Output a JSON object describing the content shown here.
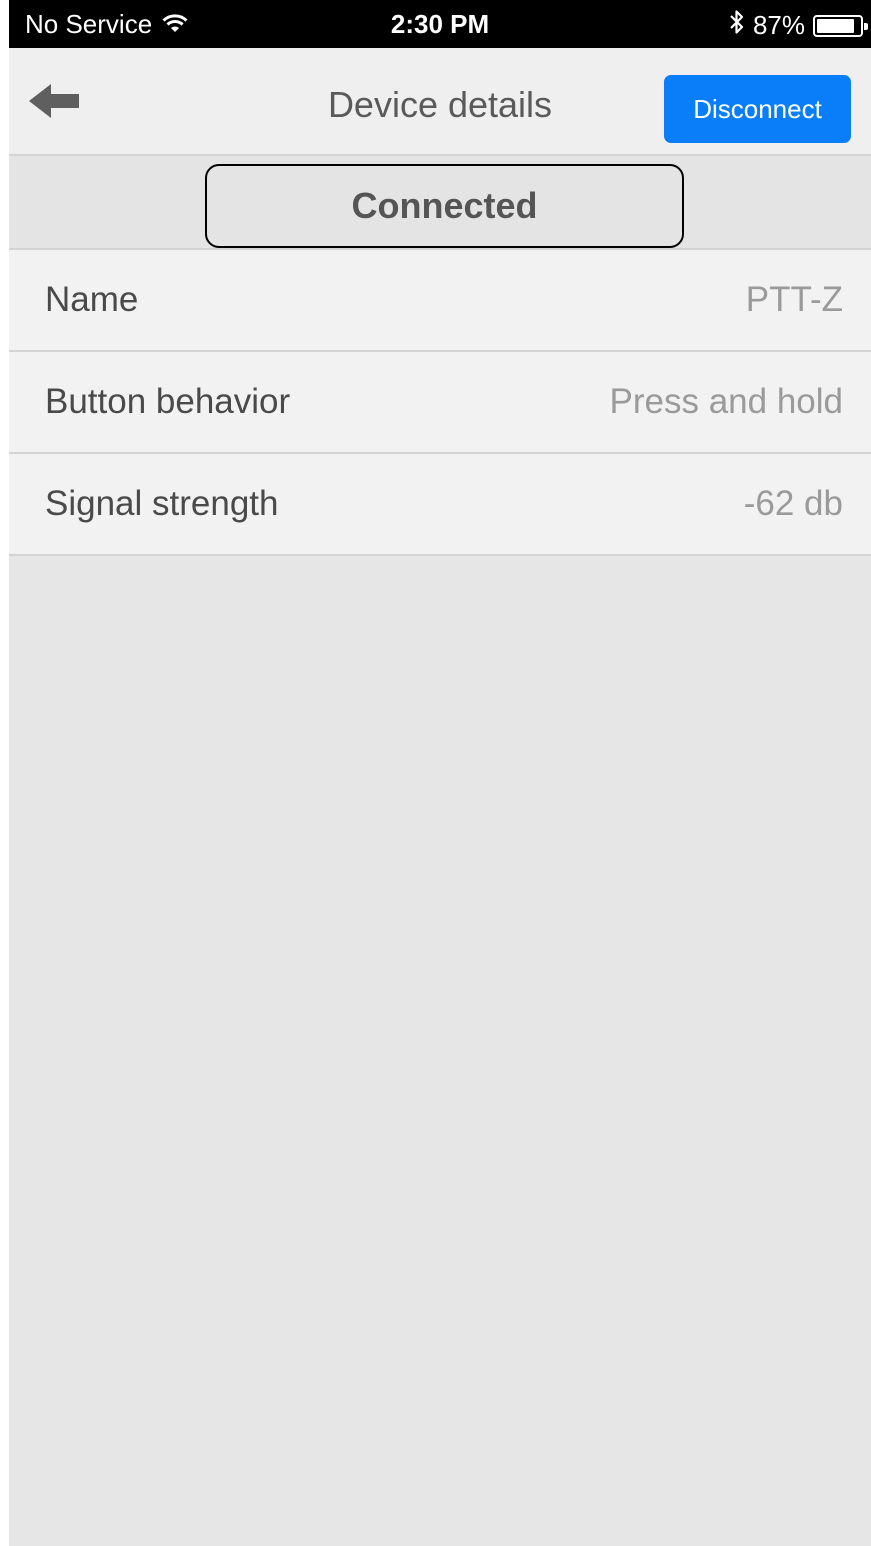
{
  "status_bar": {
    "carrier": "No Service",
    "time": "2:30 PM",
    "battery_percent": "87%",
    "battery_level": 0.87,
    "icons": [
      "wifi-icon",
      "bluetooth-icon",
      "battery-icon"
    ]
  },
  "nav": {
    "title": "Device details",
    "back_icon": "back-arrow-icon",
    "disconnect_label": "Disconnect"
  },
  "connection": {
    "status": "Connected"
  },
  "details": [
    {
      "label": "Name",
      "value": "PTT-Z"
    },
    {
      "label": "Button behavior",
      "value": "Press and hold"
    },
    {
      "label": "Signal strength",
      "value": "-62 db"
    }
  ],
  "colors": {
    "accent": "#0a7ef9",
    "nav_background": "#efefef",
    "list_background": "#f2f2f2",
    "screen_background": "#e6e6e6"
  }
}
